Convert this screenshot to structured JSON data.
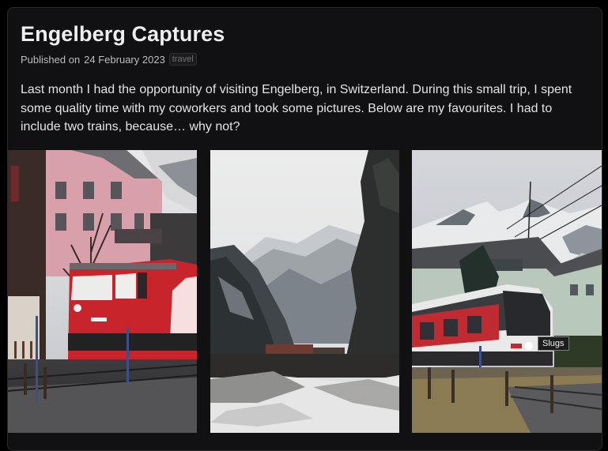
{
  "post": {
    "title": "Engelberg Captures",
    "published_prefix": "Published on",
    "date": "24 February 2023",
    "tag": "travel",
    "body": "Last month I had the opportunity of visiting Engelberg, in Switzerland. During this small trip, I spent some quality time with my coworkers and took some pictures. Below are my favourites. I had to include two trains, because… why not?"
  },
  "gallery": {
    "photos": [
      {
        "subject": "red-train-pink-building"
      },
      {
        "subject": "snowy-mountain-valley"
      },
      {
        "subject": "white-train-mountains",
        "tooltip": "Slugs"
      }
    ]
  }
}
